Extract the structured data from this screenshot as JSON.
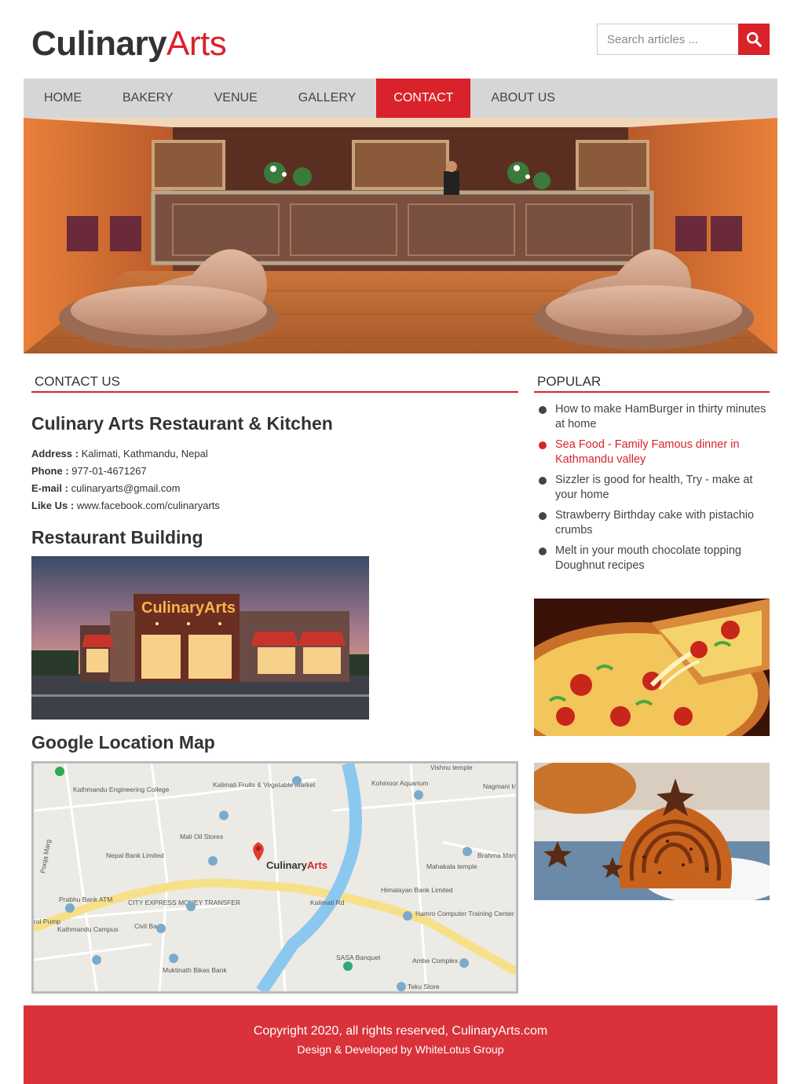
{
  "header": {
    "logo_part1": "Culinary",
    "logo_part2": "Arts",
    "search_placeholder": "Search articles ..."
  },
  "nav": {
    "items": [
      "HOME",
      "BAKERY",
      "VENUE",
      "GALLERY",
      "CONTACT",
      "ABOUT US"
    ],
    "active": "CONTACT"
  },
  "contact": {
    "section_title": "CONTACT US",
    "name": "Culinary Arts Restaurant & Kitchen",
    "address_label": "Address :",
    "address": "Kalimati, Kathmandu, Nepal",
    "phone_label": "Phone :",
    "phone": "977-01-4671267",
    "email_label": "E-mail :",
    "email": "culinaryarts@gmail.com",
    "like_label": "Like Us :",
    "like": "www.facebook.com/culinaryarts",
    "building_title": "Restaurant Building",
    "building_sign": "CulinaryArts",
    "map_title": "Google Location Map"
  },
  "map": {
    "pin_label_1": "Culinary",
    "pin_label_2": "Arts",
    "labels": [
      "Kathmandu Engineering College",
      "Kalimati Fruits & Vegetable Market",
      "Vishnu temple",
      "Kohinoor Aquarium",
      "Nagmani In",
      "Mali Oil Stores",
      "Nepal Bank Limited",
      "Brahma Marg",
      "Mahakala temple",
      "Prabhu Bank ATM",
      "CITY EXPRESS MONEY TRANSFER",
      "Kalimati Rd",
      "Himalayan Bank Limited",
      "Hamro Computer Training Center (HCTC)",
      "Civil Bank",
      "Kathmandu Campus",
      "SASA Banquet",
      "Ambe Complex",
      "Muktinath Bikas Bank",
      "Teku Store",
      "rol Pump",
      "Pooja Marg"
    ]
  },
  "popular": {
    "title": "POPULAR",
    "items": [
      "How to make HamBurger in thirty minutes at home",
      "Sea Food - Family Famous dinner in Kathmandu valley",
      "Sizzler is good for health, Try - make at your home",
      "Strawberry Birthday cake with pistachio crumbs",
      "Melt in your mouth chocolate topping Doughnut recipes"
    ],
    "highlighted_index": 1
  },
  "footer": {
    "copyright": "Copyright 2020, all rights reserved, CulinaryArts.com",
    "credit": "Design & Developed by WhiteLotus Group"
  },
  "colors": {
    "accent": "#d9222a",
    "nav_bg": "#d6d6d6",
    "text": "#333333",
    "footer_bg": "#d9323a"
  },
  "icons": {
    "search": "search-icon"
  }
}
